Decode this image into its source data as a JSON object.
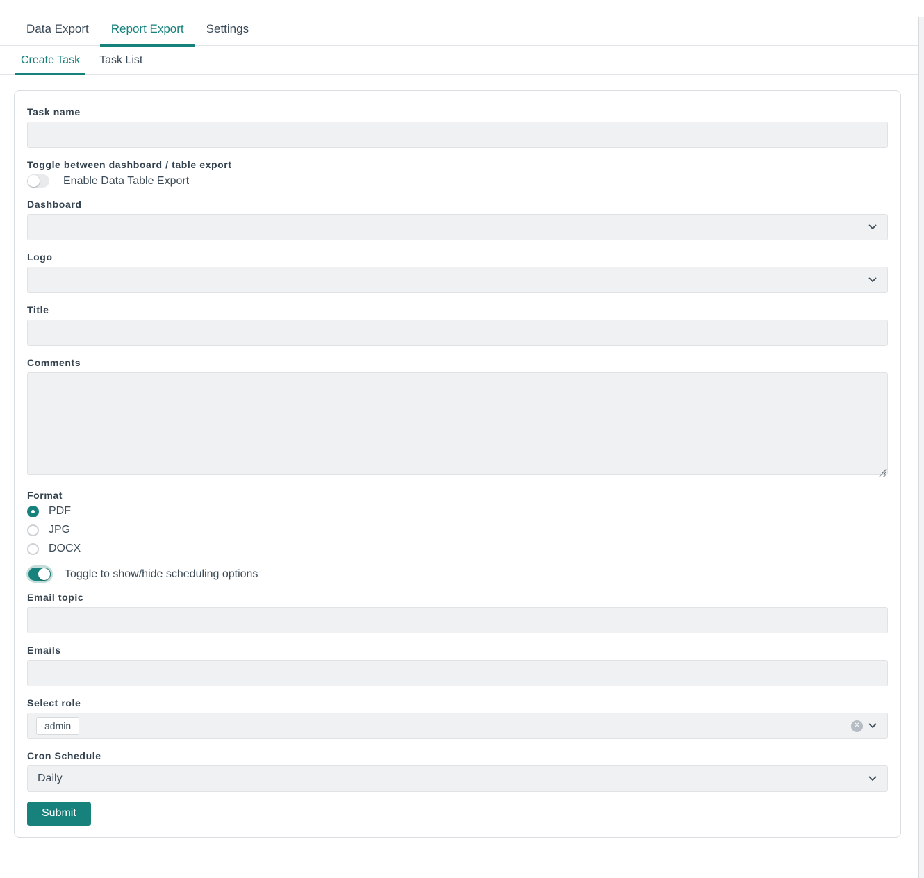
{
  "tabs": [
    {
      "label": "Data Export",
      "active": false
    },
    {
      "label": "Report Export",
      "active": true
    },
    {
      "label": "Settings",
      "active": false
    }
  ],
  "subtabs": [
    {
      "label": "Create Task",
      "active": true
    },
    {
      "label": "Task List",
      "active": false
    }
  ],
  "form": {
    "task_name": {
      "label": "Task name",
      "value": ""
    },
    "export_mode": {
      "label": "Toggle between dashboard / table export",
      "toggle_text": "Enable Data Table Export",
      "enabled": false
    },
    "dashboard": {
      "label": "Dashboard",
      "selected": ""
    },
    "logo": {
      "label": "Logo",
      "selected": ""
    },
    "title": {
      "label": "Title",
      "value": ""
    },
    "comments": {
      "label": "Comments",
      "value": ""
    },
    "format": {
      "label": "Format",
      "options": [
        "PDF",
        "JPG",
        "DOCX"
      ],
      "selected": "PDF"
    },
    "scheduling": {
      "toggle_text": "Toggle to show/hide scheduling options",
      "enabled": true
    },
    "email_topic": {
      "label": "Email topic",
      "value": ""
    },
    "emails": {
      "label": "Emails",
      "value": ""
    },
    "select_role": {
      "label": "Select role",
      "selected_roles": [
        "admin"
      ],
      "clear_glyph": "✕"
    },
    "cron_schedule": {
      "label": "Cron Schedule",
      "selected": "Daily"
    },
    "submit_label": "Submit"
  },
  "colors": {
    "accent": "#17827c",
    "label_text": "#33424e",
    "body_text": "#3c4b57",
    "field_fill": "#f0f1f3",
    "field_border": "#e0e3e6"
  }
}
